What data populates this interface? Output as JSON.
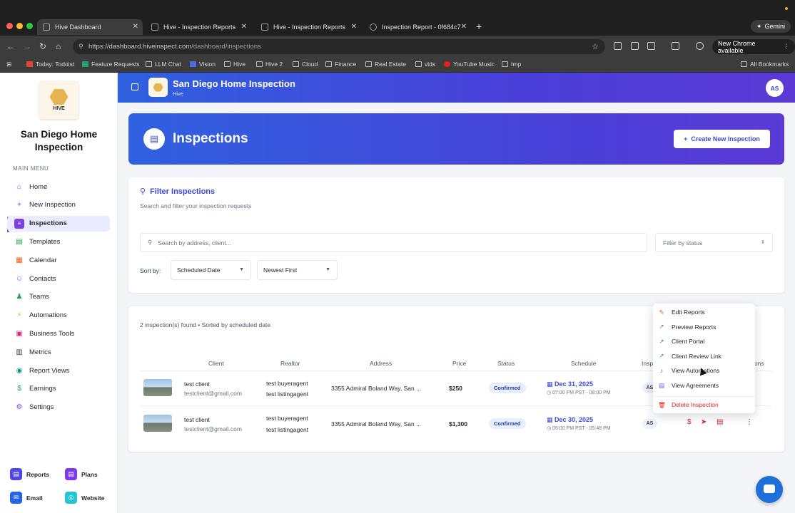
{
  "browser": {
    "tabs": [
      {
        "title": "Hive Dashboard",
        "active": true
      },
      {
        "title": "Hive - Inspection Reports",
        "active": false
      },
      {
        "title": "Hive - Inspection Reports",
        "active": false
      },
      {
        "title": "Inspection Report - 0f684c7",
        "active": false
      }
    ],
    "gemini_label": "Gemini",
    "url_host": "https://dashboard.hiveinspect.com",
    "url_path": "/dashboard/inspections",
    "new_chrome_label": "New Chrome available",
    "bookmarks": [
      "Today: Todoist",
      "Feature Requests",
      "LLM Chat",
      "Vision",
      "Hive",
      "Hive 2",
      "Cloud",
      "Finance",
      "Real Estate",
      "vids",
      "YouTube Music",
      "tmp"
    ],
    "all_bookmarks_label": "All Bookmarks"
  },
  "sidebar": {
    "logo_text": "HIVE",
    "org_name": "San Diego Home Inspection",
    "menu_label": "MAIN MENU",
    "items": [
      {
        "label": "Home",
        "icon": "home-icon",
        "glyph": "⌂",
        "color": "#3b82f6"
      },
      {
        "label": "New Inspection",
        "icon": "plus-icon",
        "glyph": "+",
        "color": "#7b3fe4"
      },
      {
        "label": "Inspections",
        "icon": "document-icon",
        "glyph": "≡",
        "color": "#7b3fe4",
        "active": true
      },
      {
        "label": "Templates",
        "icon": "template-icon",
        "glyph": "▤",
        "color": "#16a34a"
      },
      {
        "label": "Calendar",
        "icon": "calendar-icon",
        "glyph": "▦",
        "color": "#ea580c"
      },
      {
        "label": "Contacts",
        "icon": "contacts-icon",
        "glyph": "☺",
        "color": "#6366f1"
      },
      {
        "label": "Teams",
        "icon": "teams-icon",
        "glyph": "♟",
        "color": "#16a34a"
      },
      {
        "label": "Automations",
        "icon": "bolt-icon",
        "glyph": "⚡",
        "color": "#eab308"
      },
      {
        "label": "Business Tools",
        "icon": "briefcase-icon",
        "glyph": "▣",
        "color": "#db2777"
      },
      {
        "label": "Metrics",
        "icon": "bar-chart-icon",
        "glyph": "▥",
        "color": "#374151"
      },
      {
        "label": "Report Views",
        "icon": "eye-icon",
        "glyph": "◉",
        "color": "#0d9488"
      },
      {
        "label": "Earnings",
        "icon": "dollar-icon",
        "glyph": "$",
        "color": "#16a34a"
      },
      {
        "label": "Settings",
        "icon": "gear-icon",
        "glyph": "⚙",
        "color": "#7b3fe4"
      }
    ],
    "quick_links": [
      {
        "label": "Reports",
        "color": "#4f46e5",
        "glyph": "▤"
      },
      {
        "label": "Plans",
        "color": "#7c3aed",
        "glyph": "▤"
      },
      {
        "label": "Email",
        "color": "#2563eb",
        "glyph": "✉"
      },
      {
        "label": "Website",
        "color": "#22c5d4",
        "glyph": "◎"
      }
    ]
  },
  "header": {
    "title": "San Diego Home Inspection",
    "subtitle": "Hive",
    "avatar": "AS"
  },
  "page": {
    "title": "Inspections",
    "create_button": "Create New Inspection"
  },
  "filter": {
    "title": "Filter Inspections",
    "subtitle": "Search and filter your inspection requests",
    "search_placeholder": "Search by address, client...",
    "status_placeholder": "Filter by status",
    "sort_label": "Sort by:",
    "sort_field": "Scheduled Date",
    "sort_order": "Newest First"
  },
  "table": {
    "count_text": "2 inspection(s) found • Sorted by scheduled date",
    "headers": {
      "client": "Client",
      "realtor": "Realtor",
      "address": "Address",
      "price": "Price",
      "status": "Status",
      "schedule": "Schedule",
      "inspector": "Insp",
      "actions": "ons"
    },
    "rows": [
      {
        "client_name": "test client",
        "client_email": "testclient@gmail.com",
        "buyer_agent": "test buyeragent",
        "listing_agent": "test listingagent",
        "address": "3355 Admiral Boland Way, San ...",
        "price": "$250",
        "status": "Confirmed",
        "date": "Dec 31, 2025",
        "time": "07:00 PM PST - 08:00 PM",
        "inspector": "AS"
      },
      {
        "client_name": "test client",
        "client_email": "testclient@gmail.com",
        "buyer_agent": "test buyeragent",
        "listing_agent": "test listingagent",
        "address": "3355 Admiral Boland Way, San ...",
        "price": "$1,300",
        "status": "Confirmed",
        "date": "Dec 30, 2025",
        "time": "05:00 PM PST - 05:48 PM",
        "inspector": "AS"
      }
    ]
  },
  "dropdown": {
    "items": [
      {
        "label": "Edit Reports",
        "icon": "edit-icon",
        "glyph": "✎"
      },
      {
        "label": "Preview Reports",
        "icon": "external-link-icon",
        "glyph": "↗"
      },
      {
        "label": "Client Portal",
        "icon": "external-link-icon",
        "glyph": "↗"
      },
      {
        "label": "Client Review Link",
        "icon": "external-link-icon",
        "glyph": "↗"
      },
      {
        "label": "View Automations",
        "icon": "bell-icon",
        "glyph": "♪"
      },
      {
        "label": "View Agreements",
        "icon": "document-icon",
        "glyph": "▤"
      }
    ],
    "delete_label": "Delete Inspection"
  },
  "colors": {
    "accent": "#3b49d9",
    "active_nav": "#7b3fe4",
    "danger": "#dc2626"
  }
}
